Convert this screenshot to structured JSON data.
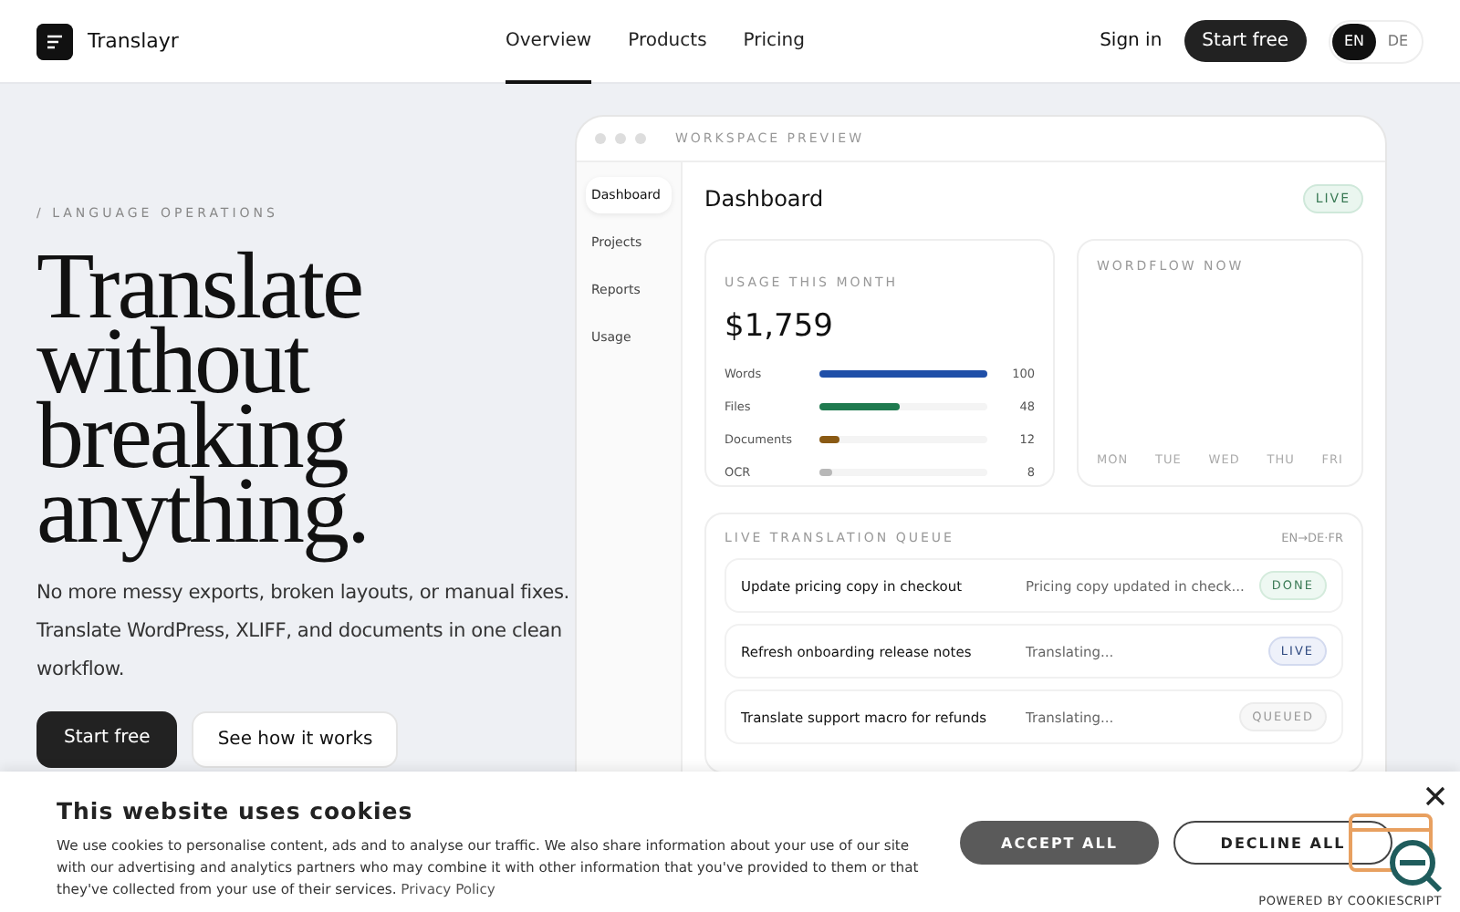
{
  "header": {
    "brand": "Translayr",
    "nav": [
      {
        "label": "Overview",
        "selected": true
      },
      {
        "label": "Products",
        "selected": false
      },
      {
        "label": "Pricing",
        "selected": false
      }
    ],
    "sign_in": "Sign in",
    "cta": "Start free",
    "languages": [
      {
        "label": "EN",
        "selected": true
      },
      {
        "label": "DE",
        "selected": false
      }
    ]
  },
  "hero": {
    "eyebrow": "/ LANGUAGE OPERATIONS",
    "headline": [
      "Translate",
      "without",
      "breaking",
      "anything."
    ],
    "description": "No more messy exports, broken layouts, or manual fixes. Translate WordPress, XLIFF, and documents in one clean workflow.",
    "primary_button": "Start free",
    "secondary_button": "See how it works"
  },
  "preview": {
    "caption": "WORKSPACE PREVIEW",
    "sidebar": [
      {
        "label": "Dashboard",
        "selected": true
      },
      {
        "label": "Projects",
        "selected": false
      },
      {
        "label": "Reports",
        "selected": false
      },
      {
        "label": "Usage",
        "selected": false
      }
    ],
    "title": "Dashboard",
    "badge": "LIVE",
    "usage": {
      "label": "USAGE THIS MONTH",
      "amount": "$1,759",
      "rows": [
        {
          "name": "Words",
          "level": 1.0,
          "value": "100",
          "color": "#1f4fa8"
        },
        {
          "name": "Files",
          "level": 0.48,
          "value": "48",
          "color": "#1f7a4f"
        },
        {
          "name": "Documents",
          "level": 0.12,
          "value": "12",
          "color": "#8a5a14"
        },
        {
          "name": "OCR",
          "level": 0.08,
          "value": "8",
          "color": "#b8b8b8"
        }
      ]
    },
    "wordflow": {
      "label": "WORDFLOW NOW",
      "days": [
        "MON",
        "TUE",
        "WED",
        "THU",
        "FRI"
      ]
    },
    "queue": {
      "label": "LIVE TRANSLATION QUEUE",
      "languages": "EN→DE·FR",
      "rows": [
        {
          "task": "Update pricing copy in checkout",
          "detail": "Pricing copy updated in check...",
          "status": "DONE",
          "kind": "done"
        },
        {
          "task": "Refresh onboarding release notes",
          "detail": "Translating...",
          "status": "LIVE",
          "kind": "live"
        },
        {
          "task": "Translate support macro for refunds",
          "detail": "Translating...",
          "status": "QUEUED",
          "kind": "queued"
        }
      ]
    }
  },
  "cookie_banner": {
    "title": "This website uses cookies",
    "text": "We use cookies to personalise content, ads and to analyse our traffic. We also share information about your use of our site with our advertising and analytics partners who may combine it with other information that you've provided to them or that they've collected from your use of their services.",
    "link": "Privacy Policy",
    "accept": "ACCEPT ALL",
    "decline": "DECLINE ALL",
    "powered_by": "POWERED BY COOKIESCRIPT"
  }
}
